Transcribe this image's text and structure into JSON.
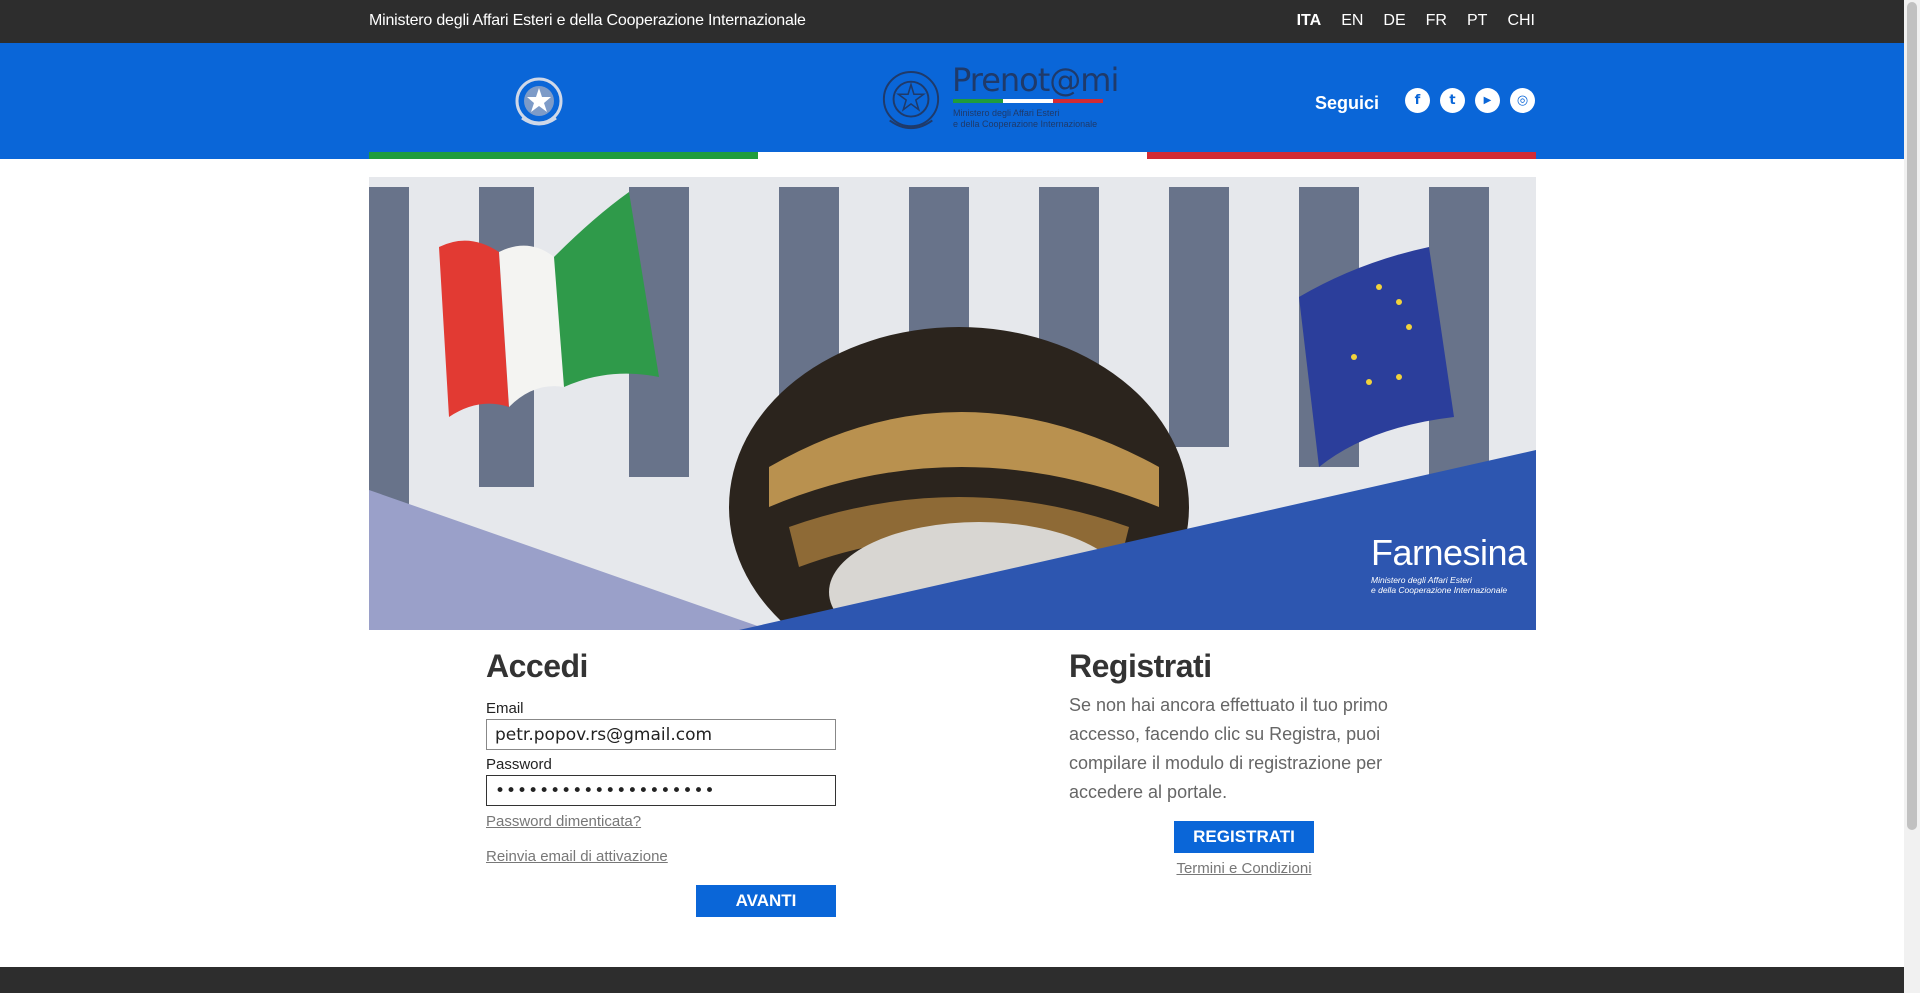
{
  "topbar": {
    "ministry": "Ministero degli Affari Esteri e della Cooperazione Internazionale",
    "languages": [
      "ITA",
      "EN",
      "DE",
      "FR",
      "PT",
      "CHI"
    ],
    "active_language": "ITA"
  },
  "header": {
    "logo_title": "Prenot@mi",
    "logo_sub_line1": "Ministero degli Affari Esteri",
    "logo_sub_line2": "e della Cooperazione Internazionale",
    "follow_label": "Seguici",
    "social": [
      {
        "icon": "facebook-icon",
        "glyph": "f"
      },
      {
        "icon": "twitter-icon",
        "glyph": "t"
      },
      {
        "icon": "youtube-icon",
        "glyph": "▶"
      },
      {
        "icon": "instagram-icon",
        "glyph": "◎"
      }
    ]
  },
  "banner": {
    "brand": "Farnesina",
    "brand_sub_line1": "Ministero degli Affari Esteri",
    "brand_sub_line2": "e della Cooperazione Internazionale"
  },
  "login": {
    "title": "Accedi",
    "email_label": "Email",
    "email_value": "petr.popov.rs@gmail.com",
    "password_label": "Password",
    "password_mask": "••••••••••••••••••••",
    "forgot_link": "Password dimenticata?",
    "resend_link": "Reinvia email di attivazione",
    "submit_label": "AVANTI"
  },
  "register": {
    "title": "Registrati",
    "description": "Se non hai ancora effettuato il tuo primo accesso, facendo clic su Registra, puoi compilare il modulo di registrazione per accedere al portale.",
    "button_label": "REGISTRATI",
    "terms_link": "Termini e Condizioni"
  },
  "colors": {
    "topbar": "#2d2d2d",
    "header_blue": "#0a66d8",
    "flag_green": "#1f9c3c",
    "flag_white": "#ffffff",
    "flag_red": "#d22b34",
    "banner_blue": "#2d56b0",
    "banner_lavender": "#9aa0c9"
  }
}
